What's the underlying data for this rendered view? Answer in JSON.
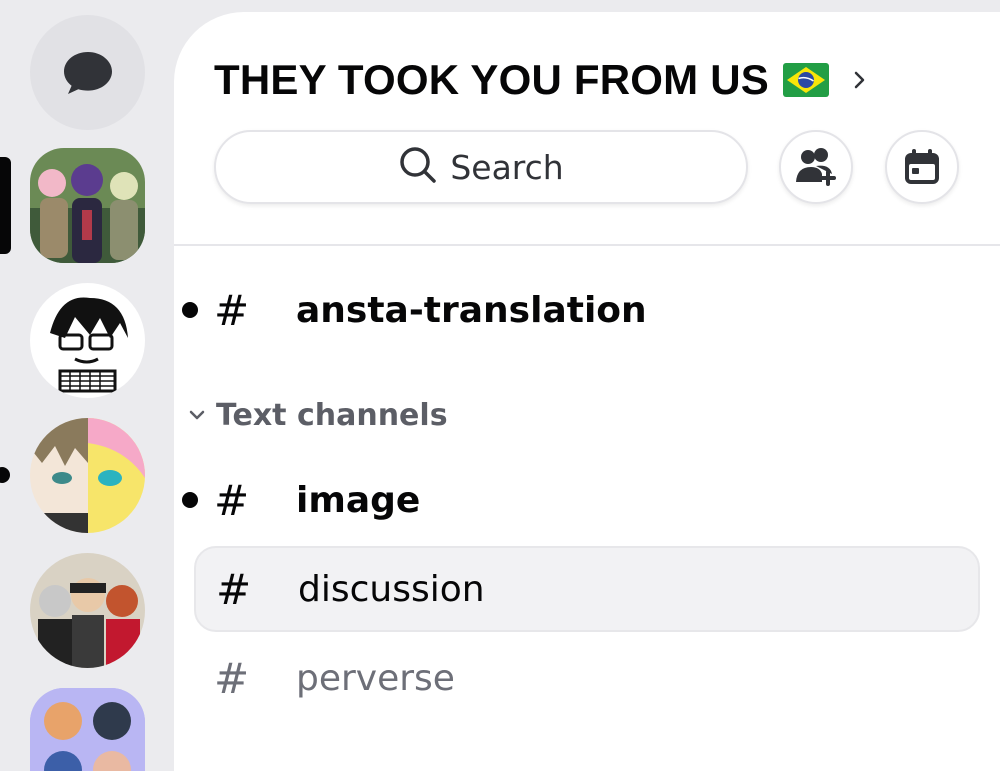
{
  "guild": {
    "name": "THEY TOOK YOU FROM US",
    "flag": "brazil-flag"
  },
  "search": {
    "label": "Search"
  },
  "header_actions": [
    "add-member-icon",
    "calendar-icon"
  ],
  "servers": [
    {
      "name": "server-1",
      "shape": "squircle",
      "selected": true
    },
    {
      "name": "server-2",
      "shape": "circle"
    },
    {
      "name": "server-3",
      "shape": "circle",
      "unread": true
    },
    {
      "name": "server-4",
      "shape": "circle"
    },
    {
      "name": "server-5",
      "shape": "squircle"
    }
  ],
  "channels": {
    "top": [
      {
        "prefix": "#",
        "name": "ansta-translation",
        "unread": true
      }
    ],
    "category": {
      "label": "Text channels",
      "items": [
        {
          "prefix": "#",
          "name": "image",
          "unread": true
        },
        {
          "prefix": "#",
          "name": "discussion",
          "selected": true
        },
        {
          "prefix": "#",
          "name": "perverse",
          "muted": true
        }
      ]
    }
  },
  "colors": {
    "rail_bg": "#ebebee",
    "panel_bg": "#ffffff",
    "text": "#060607",
    "muted_text": "#6d6f78",
    "selected_row": "#f2f2f4"
  }
}
